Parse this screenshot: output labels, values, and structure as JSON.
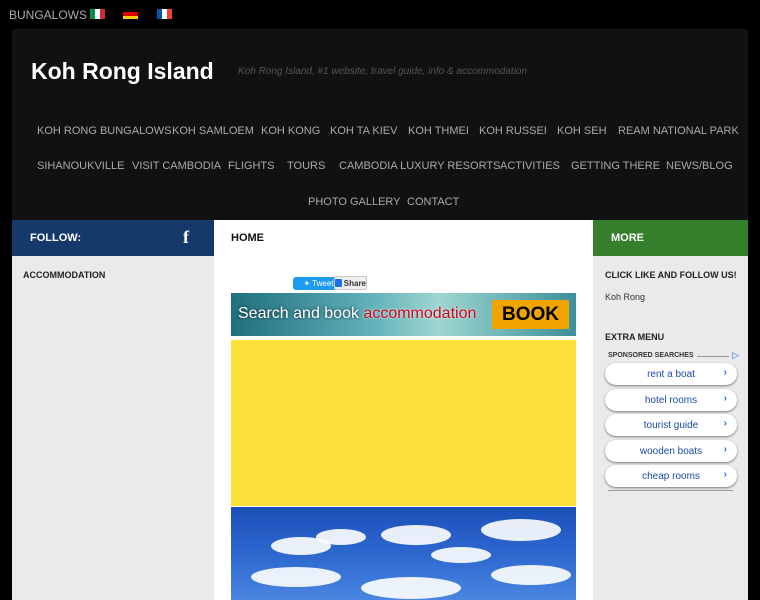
{
  "topbar": {
    "link": "BUNGALOWS",
    "flags": [
      {
        "name": "italian-flag-icon",
        "colors": [
          "#009246",
          "#ffffff",
          "#ce2b37"
        ]
      },
      {
        "name": "german-flag-icon",
        "colors": [
          "#000000",
          "#dd0000",
          "#ffce00"
        ]
      },
      {
        "name": "french-flag-icon",
        "colors": [
          "#0055a4",
          "#ffffff",
          "#ef4135"
        ]
      }
    ]
  },
  "header": {
    "title": "Koh Rong Island",
    "tagline": "Koh Rong Island, #1 website, travel guide, info & accommodation"
  },
  "nav": {
    "items": [
      "KOH RONG BUNGALOWS",
      "KOH SAMLOEM",
      "KOH KONG",
      "KOH TA KIEV",
      "KOH THMEI",
      "KOH RUSSEI",
      "KOH SEH",
      "REAM NATIONAL PARK",
      "SIHANOUKVILLE",
      "VISIT CAMBODIA",
      "FLIGHTS",
      "TOURS",
      "CAMBODIA LUXURY RESORTS",
      "ACTIVITIES",
      "GETTING THERE",
      "NEWS/BLOG",
      "PHOTO GALLERY",
      "CONTACT"
    ]
  },
  "bars": {
    "left": {
      "label": "FOLLOW:",
      "bg": "#15396b",
      "color": "#ffffff"
    },
    "middle": {
      "label": "HOME",
      "bg": "#ffffff",
      "color": "#111111"
    },
    "right": {
      "label": "MORE",
      "bg": "#347e2c",
      "color": "#ffffff"
    }
  },
  "sidebar_left": {
    "heading": "ACCOMMODATION"
  },
  "main": {
    "tweet_label": "Tweet",
    "share_label": "Share",
    "banner": {
      "text_before": "Search and book ",
      "text_highlight": "accommodation",
      "button": "BOOK"
    },
    "colors": {
      "yellow": "#fde13b"
    }
  },
  "sidebar_right": {
    "heading_follow": "CLICK LIKE AND FOLLOW US!",
    "fb_page_text": "Koh Rong",
    "heading_extra": "EXTRA MENU",
    "ads": {
      "title": "SPONSORED SEARCHES",
      "mark": "▷",
      "items": [
        "rent a boat",
        "hotel rooms",
        "tourist guide",
        "wooden boats",
        "cheap rooms"
      ]
    }
  }
}
